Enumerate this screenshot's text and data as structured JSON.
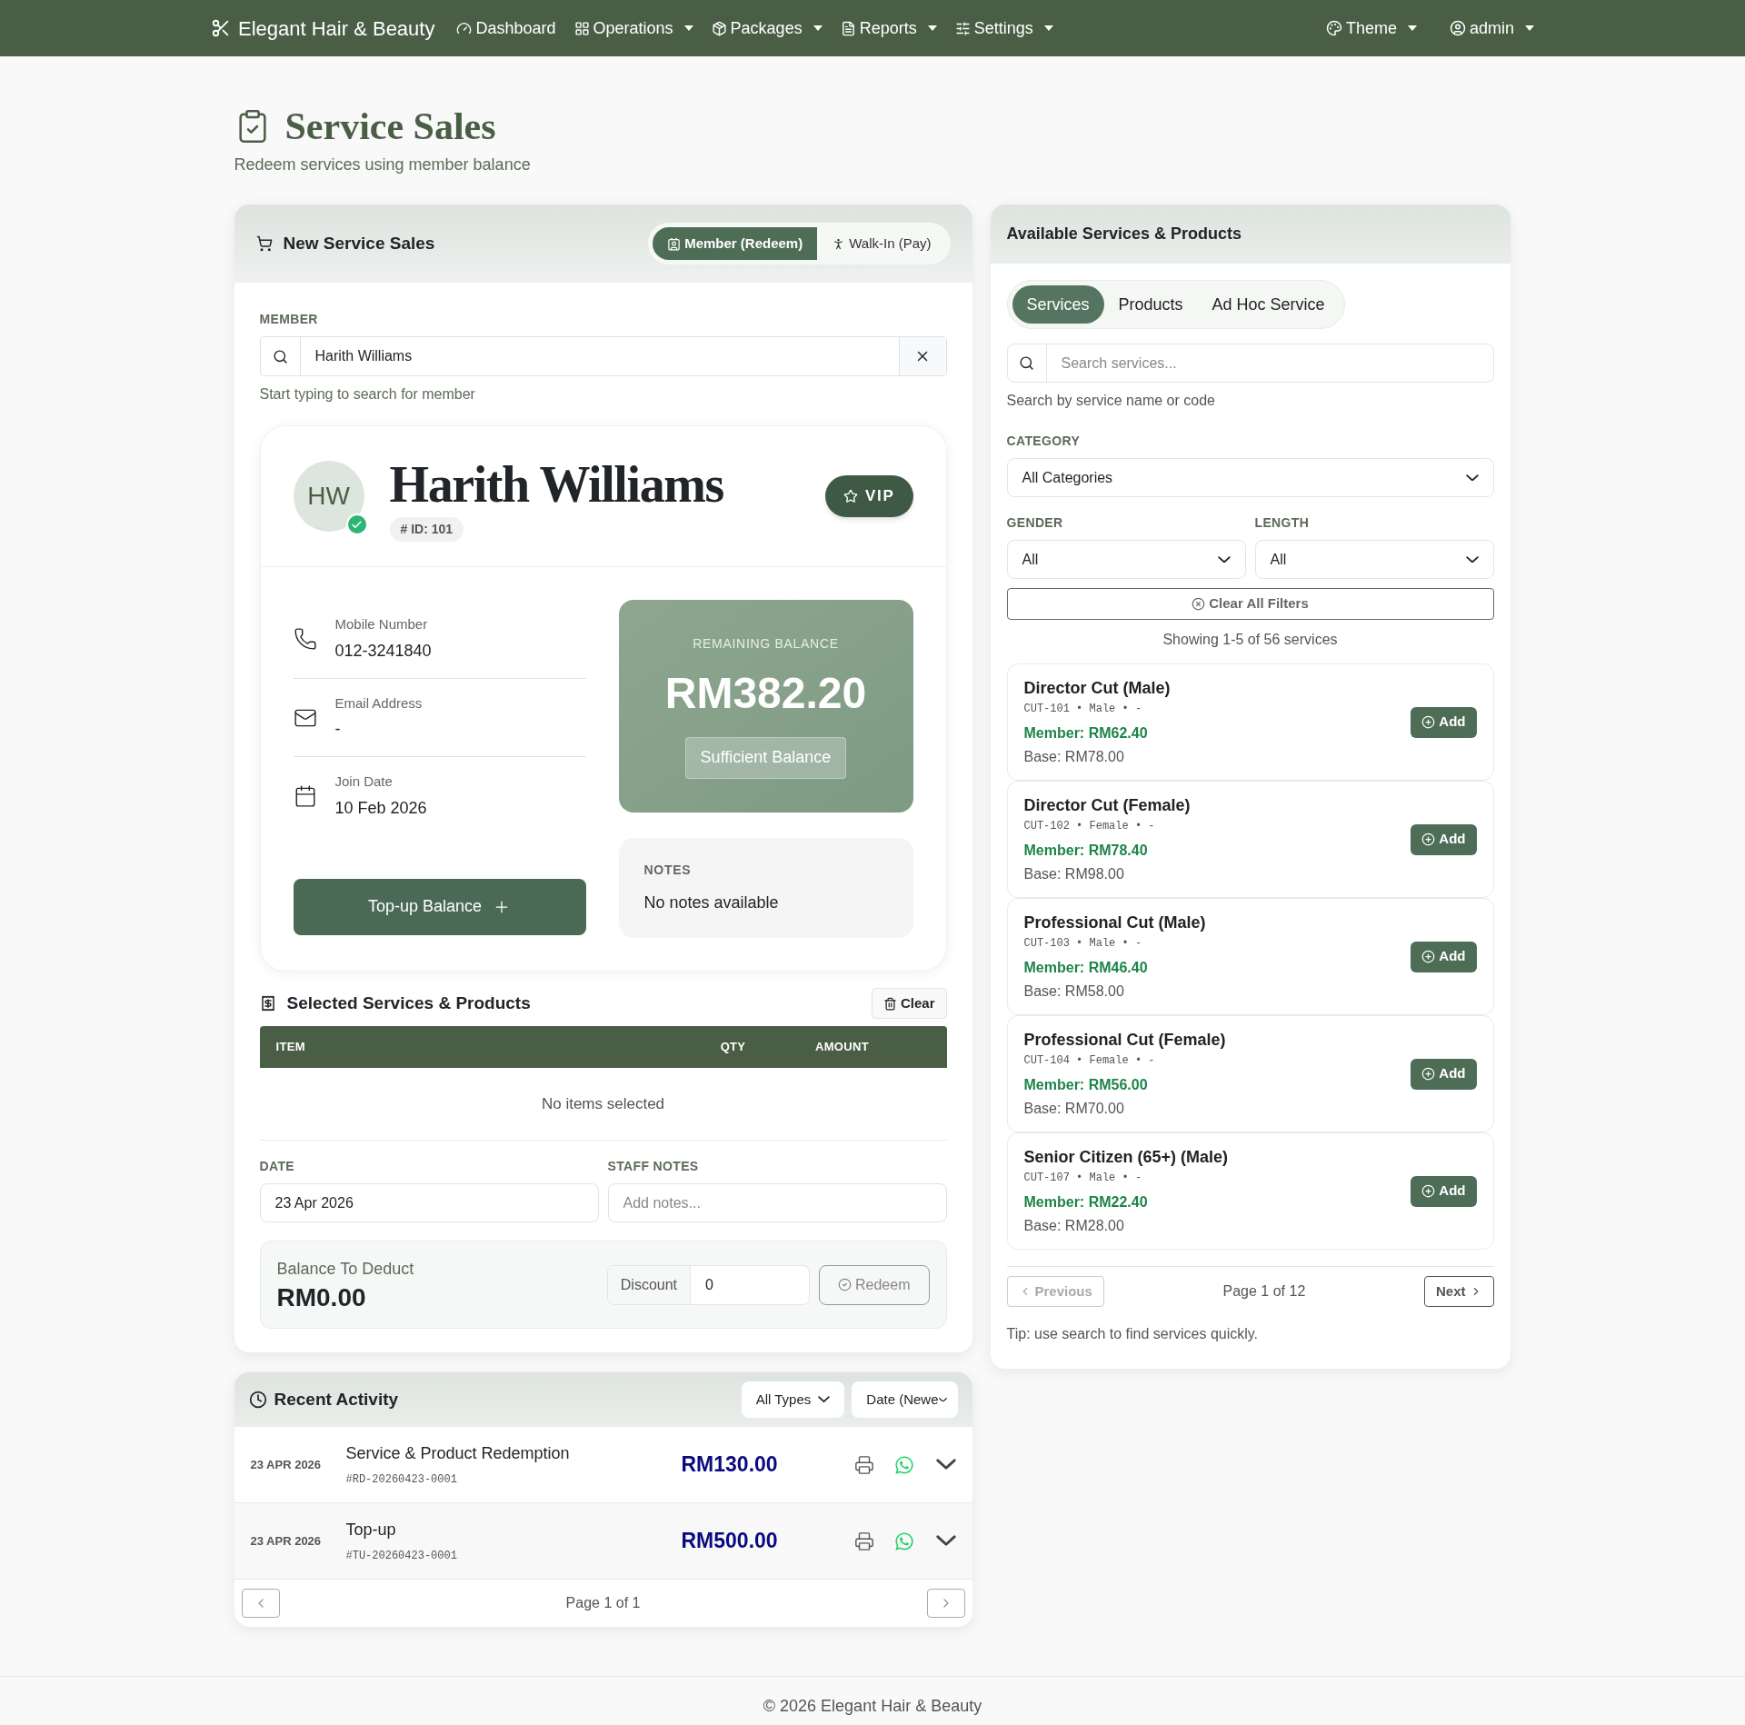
{
  "navbar": {
    "brand": "Elegant Hair & Beauty",
    "items": [
      {
        "label": "Dashboard",
        "caret": false
      },
      {
        "label": "Operations",
        "caret": true
      },
      {
        "label": "Packages",
        "caret": true
      },
      {
        "label": "Reports",
        "caret": true
      },
      {
        "label": "Settings",
        "caret": true
      }
    ],
    "right": [
      {
        "label": "Theme",
        "caret": true
      },
      {
        "label": "admin",
        "caret": true
      }
    ]
  },
  "page": {
    "title": "Service Sales",
    "subtitle": "Redeem services using member balance"
  },
  "sale_panel": {
    "title": "New Service Sales",
    "modes": [
      {
        "label": "Member (Redeem)",
        "selected": true
      },
      {
        "label": "Walk-In (Pay)",
        "selected": false
      }
    ],
    "member_label": "MEMBER",
    "member_value": "Harith Williams",
    "member_help": "Start typing to search for member",
    "member": {
      "initials": "HW",
      "verified": true,
      "name": "Harith Williams",
      "id": "# ID: 101",
      "badge": "VIP",
      "details": [
        {
          "label": "Mobile Number",
          "value": "012-3241840"
        },
        {
          "label": "Email Address",
          "value": "-"
        },
        {
          "label": "Join Date",
          "value": "10 Feb 2026"
        }
      ],
      "balance_label": "REMAINING BALANCE",
      "balance": "RM382.20",
      "balance_status": "Sufficient Balance",
      "notes_label": "NOTES",
      "notes": "No notes available",
      "topup": "Top-up Balance"
    },
    "selected_title": "Selected Services & Products",
    "clear": "Clear",
    "table": {
      "columns": [
        "ITEM",
        "QTY",
        "AMOUNT"
      ],
      "empty": "No items selected"
    },
    "date_label": "DATE",
    "date_value": "23 Apr 2026",
    "notes_label": "STAFF NOTES",
    "notes_placeholder": "Add notes...",
    "deduct_label": "Balance To Deduct",
    "deduct_value": "RM0.00",
    "discount_label": "Discount",
    "discount_value": "0",
    "redeem": "Redeem",
    "redeem_disabled": true
  },
  "activity": {
    "title": "Recent Activity",
    "type_filter": "All Types",
    "sort_filter": "Date (Newe",
    "rows": [
      {
        "date": "23 APR 2026",
        "title": "Service & Product Redemption",
        "ref": "#RD-20260423-0001",
        "amount": "RM130.00"
      },
      {
        "date": "23 APR 2026",
        "title": "Top-up",
        "ref": "#TU-20260423-0001",
        "amount": "RM500.00"
      }
    ],
    "page": "Page 1 of 1"
  },
  "catalog": {
    "title": "Available Services & Products",
    "tabs": [
      {
        "label": "Services",
        "selected": true
      },
      {
        "label": "Products",
        "selected": false
      },
      {
        "label": "Ad Hoc Service",
        "selected": false
      }
    ],
    "search_placeholder": "Search services...",
    "search_help": "Search by service name or code",
    "category_label": "CATEGORY",
    "category_value": "All Categories",
    "gender_label": "GENDER",
    "gender_value": "All",
    "length_label": "LENGTH",
    "length_value": "All",
    "clear_filters": "Clear All Filters",
    "showing": "Showing 1-5 of 56 services",
    "items": [
      {
        "name": "Director Cut (Male)",
        "meta": "CUT-101 • Male • -",
        "member_price": "Member: RM62.40",
        "base_price": "Base: RM78.00",
        "action": "Add"
      },
      {
        "name": "Director Cut (Female)",
        "meta": "CUT-102 • Female • -",
        "member_price": "Member: RM78.40",
        "base_price": "Base: RM98.00",
        "action": "Add"
      },
      {
        "name": "Professional Cut (Male)",
        "meta": "CUT-103 • Male • -",
        "member_price": "Member: RM46.40",
        "base_price": "Base: RM58.00",
        "action": "Add"
      },
      {
        "name": "Professional Cut (Female)",
        "meta": "CUT-104 • Female • -",
        "member_price": "Member: RM56.00",
        "base_price": "Base: RM70.00",
        "action": "Add"
      },
      {
        "name": "Senior Citizen (65+) (Male)",
        "meta": "CUT-107 • Male • -",
        "member_price": "Member: RM22.40",
        "base_price": "Base: RM28.00",
        "action": "Add"
      }
    ],
    "prev": "Previous",
    "prev_disabled": true,
    "page": "Page 1 of 12",
    "next": "Next",
    "tip": "Tip: use search to find services quickly."
  },
  "footer": "© 2026 Elegant Hair & Beauty"
}
